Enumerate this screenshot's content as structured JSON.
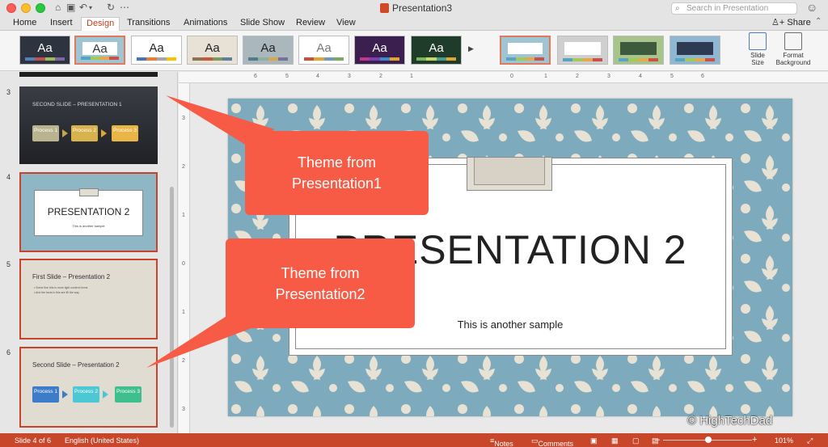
{
  "titlebar": {
    "document_title": "Presentation3",
    "search_placeholder": "Search in Presentation"
  },
  "tabs": [
    {
      "label": "Home"
    },
    {
      "label": "Insert"
    },
    {
      "label": "Design"
    },
    {
      "label": "Transitions"
    },
    {
      "label": "Animations"
    },
    {
      "label": "Slide Show"
    },
    {
      "label": "Review"
    },
    {
      "label": "View"
    }
  ],
  "share_label": "Share",
  "ribbon": {
    "theme_label": "Aa",
    "slide_size_label_1": "Slide",
    "slide_size_label_2": "Size",
    "format_bg_label_1": "Format",
    "format_bg_label_2": "Background"
  },
  "sidebar": {
    "slides": [
      {
        "number": "3",
        "title": "SECOND SLIDE – PRESENTATION 1",
        "processes": [
          "Process 1",
          "Process 2",
          "Process 3"
        ]
      },
      {
        "number": "4",
        "title": "PRESENTATION 2",
        "subtitle": "This is another sample"
      },
      {
        "number": "5",
        "title": "First Slide – Presentation 2",
        "bullets": [
          "Some fine this is more light content forms",
          "And the facts in this are fill the way"
        ]
      },
      {
        "number": "6",
        "title": "Second Slide – Presentation 2",
        "processes": [
          "Process 1",
          "Process 2",
          "Process 3"
        ]
      }
    ]
  },
  "ruler": {
    "h_labels": [
      "6",
      "5",
      "4",
      "3",
      "2",
      "1",
      "0",
      "1",
      "2",
      "3",
      "4",
      "5",
      "6"
    ],
    "v_labels": [
      "3",
      "2",
      "1",
      "0",
      "1",
      "2",
      "3"
    ]
  },
  "slide": {
    "title": "PRESENTATION 2",
    "subtitle": "This is another sample"
  },
  "callouts": {
    "first": "Theme from Presentation1",
    "second": "Theme from Presentation2"
  },
  "status": {
    "slide_position": "Slide 4 of 6",
    "language": "English (United States)",
    "notes_label": "Notes",
    "comments_label": "Comments",
    "zoom": "101%"
  },
  "watermark": "© HighTechDad",
  "colors": {
    "accent": "#c43e1c",
    "status_bar": "#c8462a",
    "callout": "#f75a45",
    "slide_bg": "#7dabbd"
  }
}
